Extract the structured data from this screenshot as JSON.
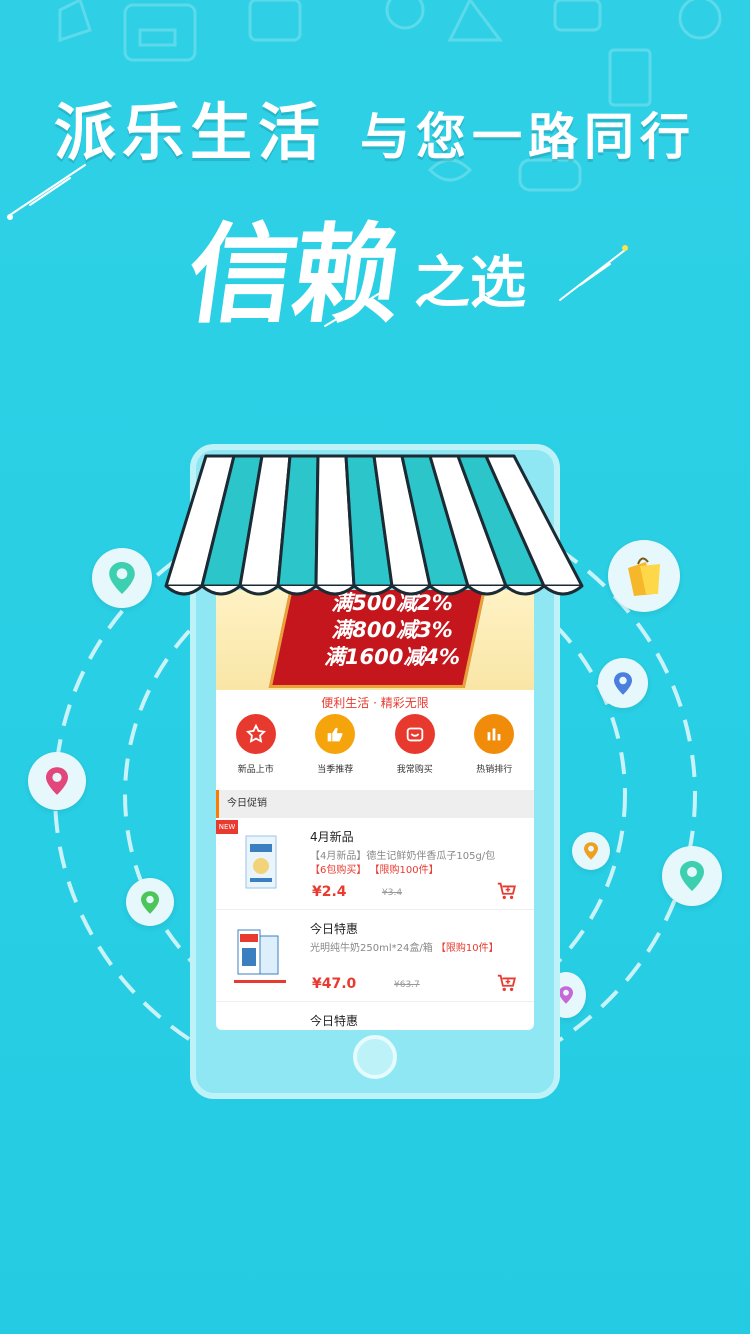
{
  "headline": {
    "part1": "派乐生活",
    "part2": "与您一路同行"
  },
  "sub_headline": {
    "big": "信赖",
    "small": "之选"
  },
  "banner": {
    "lines": [
      "满500减2%",
      "满800减3%",
      "满1600减4%"
    ],
    "slogan": "便利生活 · 精彩无限"
  },
  "shortcuts": [
    {
      "label": "新品上市",
      "color": "#e8392f",
      "icon": "star-icon"
    },
    {
      "label": "当季推荐",
      "color": "#f5a40b",
      "icon": "thumbs-up-icon"
    },
    {
      "label": "我常购买",
      "color": "#e8392f",
      "icon": "basket-icon"
    },
    {
      "label": "热销排行",
      "color": "#f08c0a",
      "icon": "bar-chart-icon"
    }
  ],
  "section": {
    "title": "今日促销"
  },
  "products": [
    {
      "title": "4月新品",
      "desc": "【4月新品】德生记鲜奶伴香瓜子105g/包",
      "tags": "【6包购买】 【限购100件】",
      "price": "¥2.4",
      "old_price": "¥3.4",
      "hot_label": "NEW"
    },
    {
      "title": "今日特惠",
      "desc": "光明纯牛奶250ml*24盒/箱",
      "tags": "【限购10件】",
      "price": "¥47.0",
      "old_price": "¥63.7"
    },
    {
      "title": "今日特惠"
    }
  ],
  "colors": {
    "accent": "#29cfe4",
    "red": "#e83a2f",
    "orange": "#ff7a00"
  }
}
